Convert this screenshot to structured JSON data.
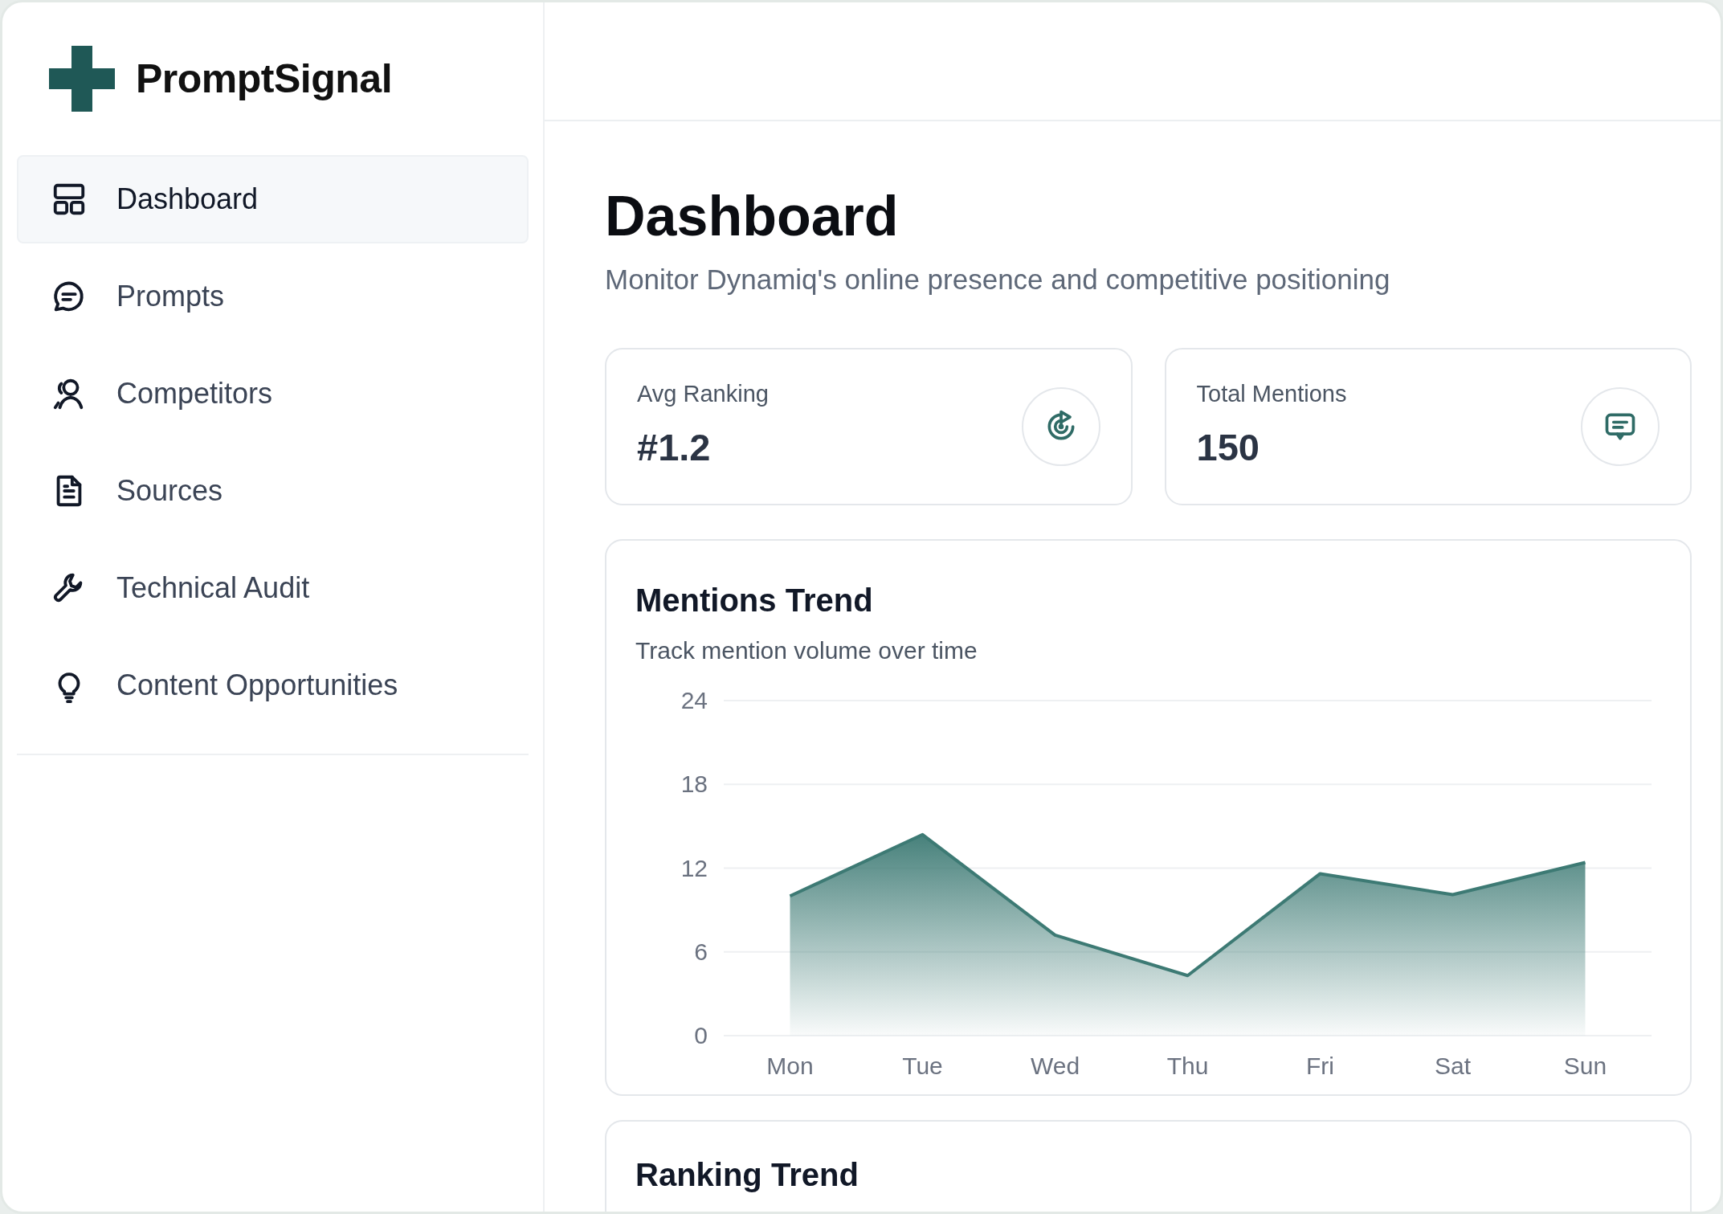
{
  "brand": {
    "name": "PromptSignal"
  },
  "sidebar": {
    "items": [
      {
        "label": "Dashboard",
        "selected": true
      },
      {
        "label": "Prompts",
        "selected": false
      },
      {
        "label": "Competitors",
        "selected": false
      },
      {
        "label": "Sources",
        "selected": false
      },
      {
        "label": "Technical Audit",
        "selected": false
      },
      {
        "label": "Content Opportunities",
        "selected": false
      }
    ]
  },
  "page": {
    "title": "Dashboard",
    "subtitle": "Monitor Dynamiq's online presence and competitive positioning"
  },
  "stats": [
    {
      "label": "Avg Ranking",
      "value": "#1.2"
    },
    {
      "label": "Total Mentions",
      "value": "150"
    }
  ],
  "mentions_trend": {
    "title": "Mentions Trend",
    "subtitle": "Track mention volume over time",
    "chart_data": {
      "type": "area",
      "categories": [
        "Mon",
        "Tue",
        "Wed",
        "Thu",
        "Fri",
        "Sat",
        "Sun"
      ],
      "series": [
        {
          "color": "#3d7a74",
          "values": [
            10,
            14.4,
            7.2,
            4.3,
            11.6,
            10.1,
            12.4
          ]
        }
      ],
      "ylim": [
        0,
        24
      ],
      "yticks": [
        0,
        6,
        12,
        18,
        24
      ],
      "grid": true
    }
  },
  "ranking_trend": {
    "title": "Ranking Trend"
  }
}
